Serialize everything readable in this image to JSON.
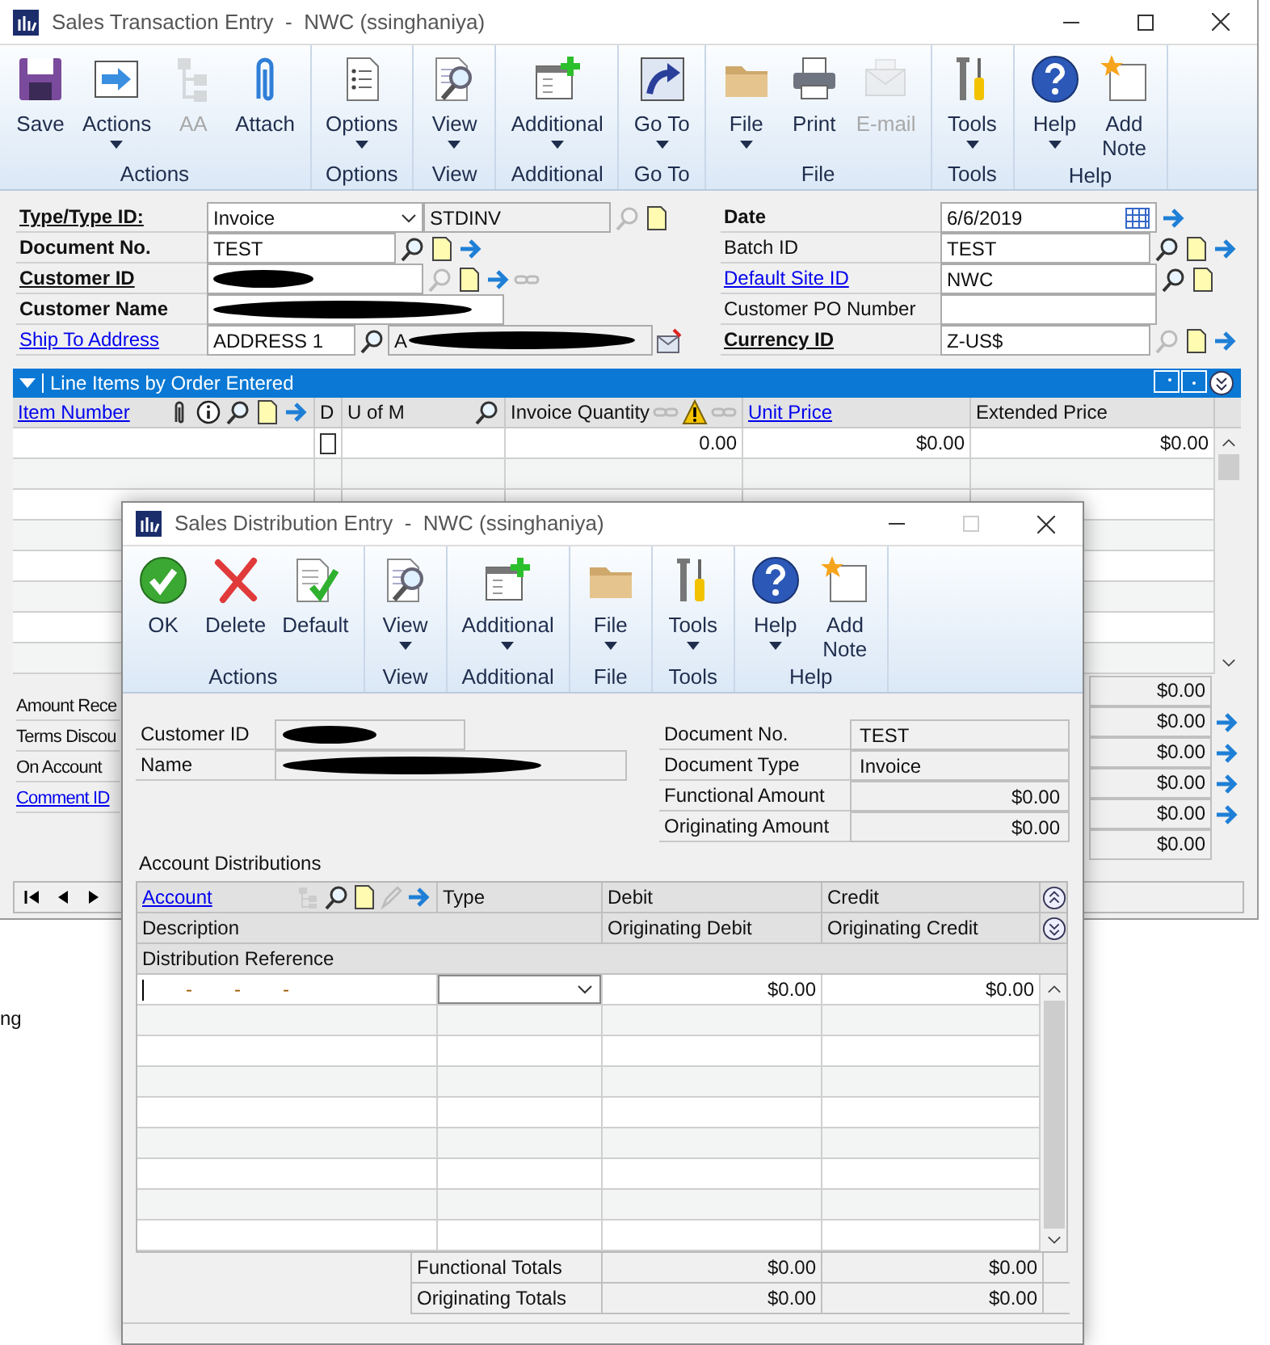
{
  "main_window": {
    "title": "Sales Transaction Entry  -  NWC (ssinghaniya)",
    "ribbon": [
      {
        "label": "Actions",
        "buttons": [
          {
            "label": "Save",
            "dropdown": false,
            "disabled": false
          },
          {
            "label": "Actions",
            "dropdown": true,
            "disabled": false
          },
          {
            "label": "AA",
            "dropdown": false,
            "disabled": true
          },
          {
            "label": "Attach",
            "dropdown": false,
            "disabled": false
          }
        ]
      },
      {
        "label": "Options",
        "buttons": [
          {
            "label": "Options",
            "dropdown": true,
            "disabled": false
          }
        ]
      },
      {
        "label": "View",
        "buttons": [
          {
            "label": "View",
            "dropdown": true,
            "disabled": false
          }
        ]
      },
      {
        "label": "Additional",
        "buttons": [
          {
            "label": "Additional",
            "dropdown": true,
            "disabled": false
          }
        ]
      },
      {
        "label": "Go To",
        "buttons": [
          {
            "label": "Go To",
            "dropdown": true,
            "disabled": false
          }
        ]
      },
      {
        "label": "File",
        "buttons": [
          {
            "label": "File",
            "dropdown": true,
            "disabled": false
          },
          {
            "label": "Print",
            "dropdown": false,
            "disabled": false
          },
          {
            "label": "E-mail",
            "dropdown": false,
            "disabled": true
          }
        ]
      },
      {
        "label": "Tools",
        "buttons": [
          {
            "label": "Tools",
            "dropdown": true,
            "disabled": false
          }
        ]
      },
      {
        "label": "Help",
        "buttons": [
          {
            "label": "Help",
            "dropdown": true,
            "disabled": false
          },
          {
            "label": "Add Note",
            "dropdown": false,
            "disabled": false
          }
        ]
      }
    ],
    "fields_left": [
      {
        "label": "Type/Type ID:",
        "required": true,
        "link": true,
        "value": "Invoice",
        "dropdown": true,
        "value_2": "STDINV"
      },
      {
        "label": "Document No.",
        "required": true,
        "link": false,
        "value": "TEST"
      },
      {
        "label": "Customer ID",
        "required": true,
        "link": true,
        "redacted": true
      },
      {
        "label": "Customer Name",
        "required": true,
        "link": false,
        "redacted": true
      },
      {
        "label": "Ship To Address",
        "required": false,
        "link": true,
        "value": "ADDRESS 1",
        "value_2": "A",
        "redacted_2": true
      }
    ],
    "fields_right": [
      {
        "label": "Date",
        "required": true,
        "link": false,
        "value": "6/6/2019",
        "calendar": true
      },
      {
        "label": "Batch ID",
        "required": false,
        "link": false,
        "value": "TEST"
      },
      {
        "label": "Default Site ID",
        "required": false,
        "link": true,
        "value": "NWC"
      },
      {
        "label": "Customer PO Number",
        "required": false,
        "link": false
      },
      {
        "label": "Currency ID",
        "required": true,
        "link": true,
        "value": "Z-US$"
      }
    ],
    "line_items": {
      "title": "Line Items by Order Entered",
      "columns": [
        {
          "label": "Item Number",
          "link": true
        },
        {
          "label": "D",
          "link": false
        },
        {
          "label": "U of M",
          "link": false
        },
        {
          "label": "Invoice Quantity",
          "link": false
        },
        {
          "label": "Unit Price",
          "link": true
        },
        {
          "label": "Extended Price",
          "link": false
        }
      ],
      "rows": [
        {
          "distribute": false,
          "invoice_quantity": "0.00",
          "unit_price": "$0.00",
          "extended_price": "$0.00"
        }
      ]
    },
    "summary_labels": [
      {
        "label": "Amount Rece",
        "link": false
      },
      {
        "label": "Terms Discou",
        "link": false
      },
      {
        "label": "On Account",
        "link": false
      },
      {
        "label": "Comment ID",
        "link": true
      }
    ],
    "summary_values": [
      {
        "value": "$0.00",
        "arrow": false
      },
      {
        "value": "$0.00",
        "arrow": true
      },
      {
        "value": "$0.00",
        "arrow": true
      },
      {
        "value": "$0.00",
        "arrow": true
      },
      {
        "value": "$0.00",
        "arrow": true
      },
      {
        "value": "$0.00",
        "arrow": false
      }
    ]
  },
  "background_text": "ng",
  "distribution_window": {
    "title": "Sales Distribution Entry  -  NWC (ssinghaniya)",
    "ribbon": [
      {
        "label": "Actions",
        "buttons": [
          {
            "label": "OK",
            "dropdown": false,
            "disabled": false
          },
          {
            "label": "Delete",
            "dropdown": false,
            "disabled": false
          },
          {
            "label": "Default",
            "dropdown": false,
            "disabled": false
          }
        ]
      },
      {
        "label": "View",
        "buttons": [
          {
            "label": "View",
            "dropdown": true,
            "disabled": false
          }
        ]
      },
      {
        "label": "Additional",
        "buttons": [
          {
            "label": "Additional",
            "dropdown": true,
            "disabled": false
          }
        ]
      },
      {
        "label": "File",
        "buttons": [
          {
            "label": "File",
            "dropdown": true,
            "disabled": false
          }
        ]
      },
      {
        "label": "Tools",
        "buttons": [
          {
            "label": "Tools",
            "dropdown": true,
            "disabled": false
          }
        ]
      },
      {
        "label": "Help",
        "buttons": [
          {
            "label": "Help",
            "dropdown": true,
            "disabled": false
          },
          {
            "label": "Add Note",
            "dropdown": false,
            "disabled": false
          }
        ]
      }
    ],
    "customer": [
      {
        "label": "Customer ID",
        "redacted": true
      },
      {
        "label": "Name",
        "redacted": true
      }
    ],
    "document": [
      {
        "label": "Document No.",
        "value": "TEST",
        "kind": "text"
      },
      {
        "label": "Document Type",
        "value": "Invoice",
        "kind": "text"
      },
      {
        "label": "Functional Amount",
        "value": "$0.00",
        "kind": "amount"
      },
      {
        "label": "Originating Amount",
        "value": "$0.00",
        "kind": "amount"
      }
    ],
    "section_label": "Account Distributions",
    "grid": {
      "header_rows": [
        [
          {
            "label": "Account",
            "link": true
          },
          {
            "label": "Type",
            "link": false
          },
          {
            "label": "Debit",
            "link": false
          },
          {
            "label": "Credit",
            "link": false
          }
        ],
        [
          {
            "label": "Description",
            "link": false
          },
          {
            "label": "Originating Debit",
            "link": false
          },
          {
            "label": "Originating Credit",
            "link": false
          }
        ],
        [
          {
            "label": "Distribution Reference",
            "link": false
          }
        ]
      ],
      "rows": [
        {
          "account_separators": [
            "-",
            "-",
            "-"
          ],
          "debit": "$0.00",
          "credit": "$0.00"
        }
      ],
      "totals": [
        {
          "label": "Functional Totals",
          "debit": "$0.00",
          "credit": "$0.00"
        },
        {
          "label": "Originating Totals",
          "debit": "$0.00",
          "credit": "$0.00"
        }
      ]
    }
  }
}
